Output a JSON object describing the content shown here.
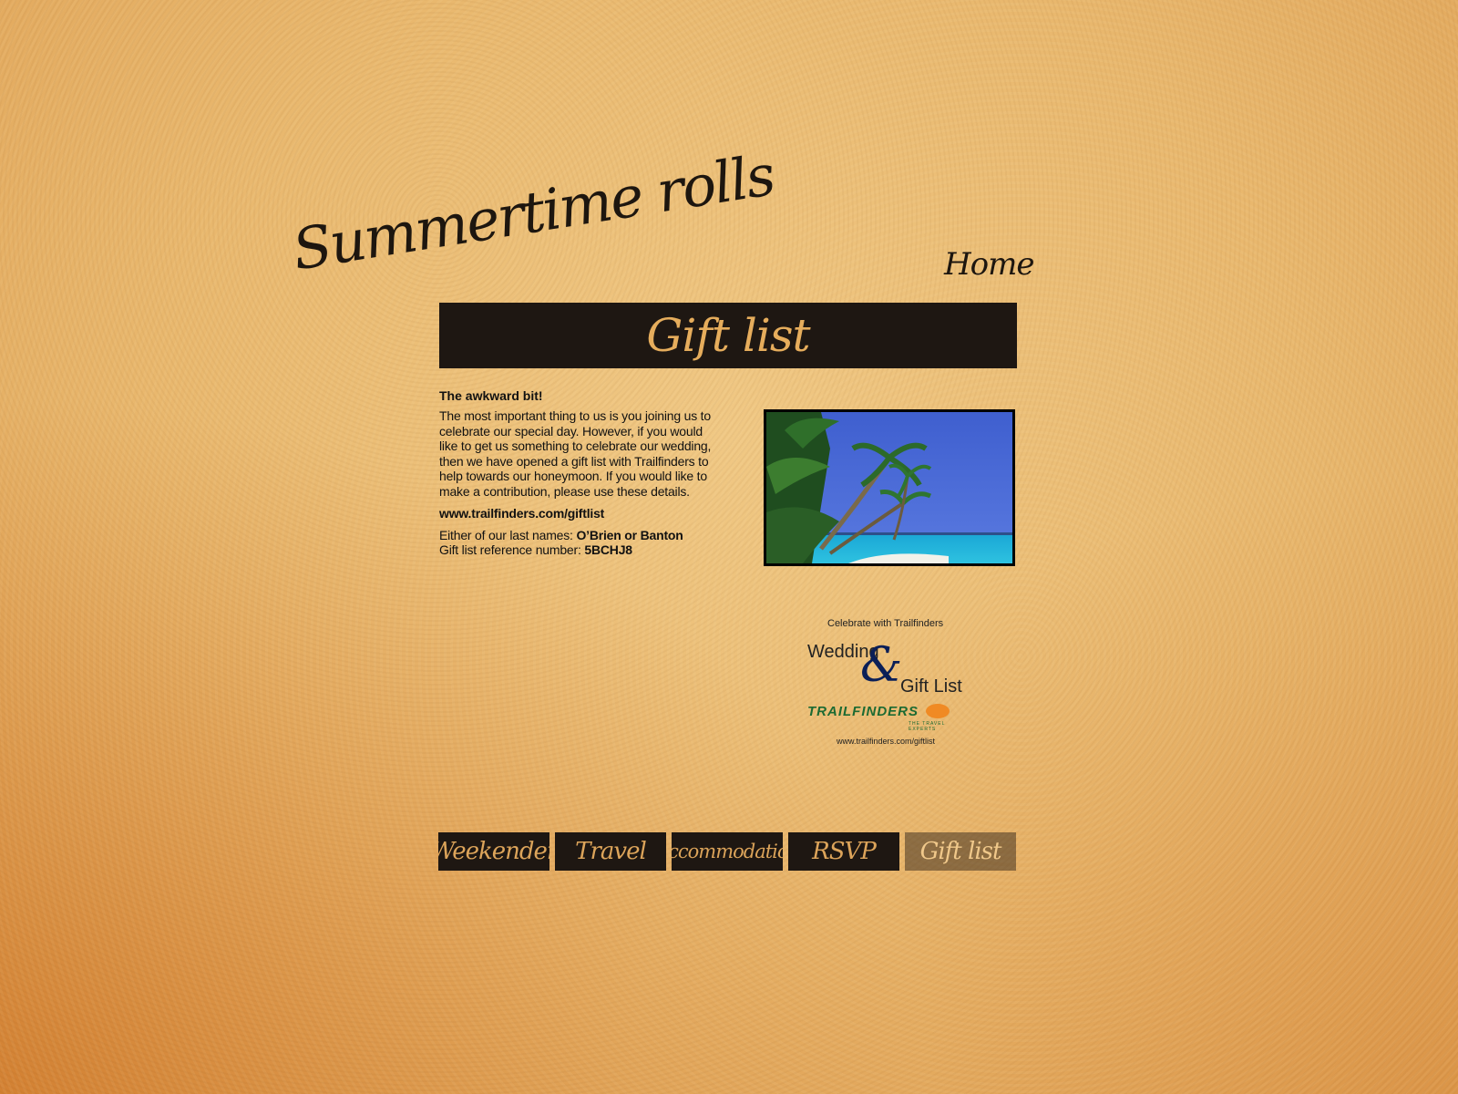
{
  "site": {
    "title": "Summertime rolls",
    "home_label": "Home"
  },
  "banner": {
    "title": "Gift list"
  },
  "content": {
    "heading": "The awkward bit!",
    "body": "The most important thing to us is you joining us to celebrate our special day. However, if you would like to get us something to celebrate our wedding, then we have opened a gift list with Trailfinders to help towards our honeymoon. If you would like to make a contribution, please use these details.",
    "url": "www.trailfinders.com/giftlist",
    "names_label": "Either of our last names:",
    "names_value": "O’Brien or Banton",
    "reference_label": "Gift list reference number:",
    "reference_value": "5BCHJ8"
  },
  "logo": {
    "celebrate": "Celebrate with Trailfinders",
    "wedding": "Wedding",
    "ampersand": "&",
    "gift_list": "Gift List",
    "brand": "TRAILFINDERS",
    "tagline": "THE TRAVEL EXPERTS",
    "url": "www.trailfinders.com/giftlist"
  },
  "nav": {
    "items": [
      {
        "label": "Weekender",
        "active": false
      },
      {
        "label": "Travel",
        "active": false
      },
      {
        "label": "Accommodation",
        "active": false
      },
      {
        "label": "RSVP",
        "active": false
      },
      {
        "label": "Gift list",
        "active": true
      }
    ]
  },
  "colors": {
    "banner_bg": "#1e1712",
    "banner_text": "#e6ad5c",
    "paper": "#e9b86e"
  }
}
